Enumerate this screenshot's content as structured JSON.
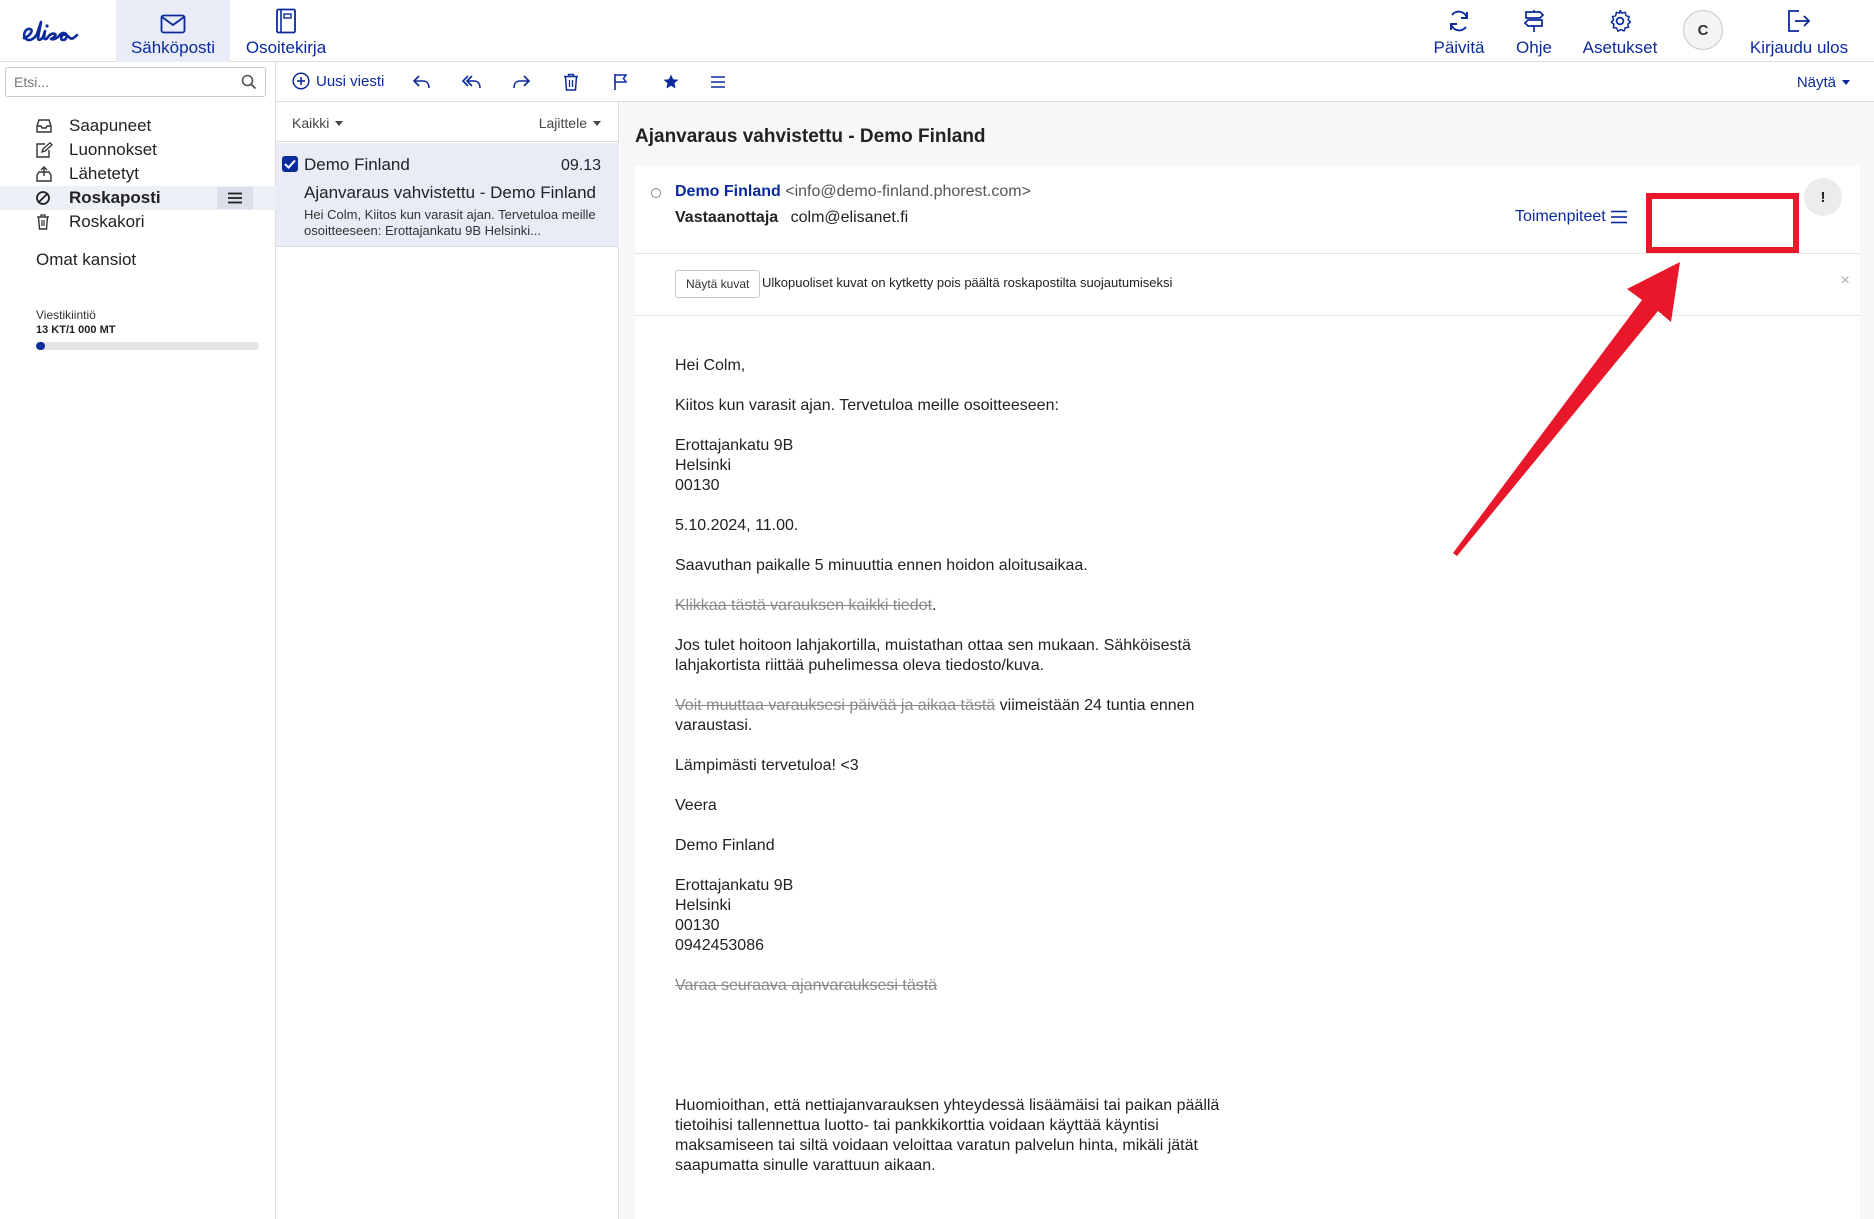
{
  "header": {
    "brand": "elisa",
    "tabs": [
      {
        "label": "Sähköposti",
        "icon": "mail-icon",
        "active": true
      },
      {
        "label": "Osoitekirja",
        "icon": "address-book-icon",
        "active": false
      }
    ],
    "buttons": {
      "refresh": "Päivitä",
      "help": "Ohje",
      "settings": "Asetukset",
      "avatar": "C",
      "logout": "Kirjaudu ulos"
    }
  },
  "sidebar": {
    "search_placeholder": "Etsi...",
    "folders": [
      {
        "label": "Saapuneet",
        "icon": "inbox-icon"
      },
      {
        "label": "Luonnokset",
        "icon": "drafts-icon"
      },
      {
        "label": "Lähetetyt",
        "icon": "sent-icon"
      },
      {
        "label": "Roskaposti",
        "icon": "spam-icon",
        "active": true
      },
      {
        "label": "Roskakori",
        "icon": "trash-icon"
      }
    ],
    "own_folders": "Omat kansiot",
    "quota": {
      "label": "Viestikiintiö",
      "value": "13 KT/1 000 MT",
      "fraction": 0.04
    }
  },
  "toolbar": {
    "new_message": "Uusi viesti",
    "show": "Näytä"
  },
  "list": {
    "filter": "Kaikki",
    "sort": "Lajittele",
    "messages": [
      {
        "sender": "Demo Finland",
        "date": "09.13",
        "subject": "Ajanvaraus vahvistettu - Demo Finland",
        "preview": "Hei Colm, Kiitos kun varasit ajan. Tervetuloa meille osoitteeseen: Erottajankatu 9B Helsinki...",
        "checked": true
      }
    ]
  },
  "reader": {
    "subject": "Ajanvaraus vahvistettu - Demo Finland",
    "from_name": "Demo Finland",
    "from_email": "<info@demo-finland.phorest.com>",
    "to_label": "Vastaanottaja",
    "to_email": "colm@elisanet.fi",
    "actions": "Toimenpiteet",
    "flag": "!",
    "show_images": "Näytä kuvat",
    "images_notice": "Ulkopuoliset kuvat on kytketty pois päältä roskapostilta suojautumiseksi",
    "close": "×",
    "body": {
      "greeting": "Hei Colm,",
      "thanks": "Kiitos kun varasit ajan. Tervetuloa meille osoitteeseen:",
      "addr1": {
        "street": "Erottajankatu 9B",
        "city": "Helsinki",
        "zip": "00130"
      },
      "datetime": "5.10.2024, 11.00.",
      "arrive": "Saavuthan paikalle 5 minuuttia ennen hoidon aloitusaikaa.",
      "details_link": "Klikkaa tästä varauksen kaikki tiedot",
      "details_dot": ".",
      "giftcard": "Jos tulet hoitoon lahjakortilla, muistathan ottaa sen mukaan. Sähköisestä lahjakortista riittää puhelimessa oleva tiedosto/kuva.",
      "change_link": "Voit muuttaa varauksesi päivää ja aikaa tästä",
      "change_rest": " viimeistään 24 tuntia ennen varaustasi.",
      "welcome": "Lämpimästi tervetuloa! <3",
      "signer": "Veera",
      "company": "Demo Finland",
      "addr2": {
        "street": "Erottajankatu 9B",
        "city": "Helsinki",
        "zip": "00130",
        "phone": "0942453086"
      },
      "next_link": "Varaa seuraava ajanvarauksesi tästä",
      "notice": "Huomioithan, että nettiajanvarauksen yhteydessä lisäämäisi tai paikan päällä tietoihisi tallennettua luotto- tai pankkikorttia voidaan käyttää käyntisi maksamiseen tai siltä voidaan veloittaa varatun palvelun hinta, mikäli jätät saapumatta sinulle varattuun aikaan."
    }
  },
  "colors": {
    "brand": "#0b2a9c",
    "annotation": "#e8182a"
  }
}
